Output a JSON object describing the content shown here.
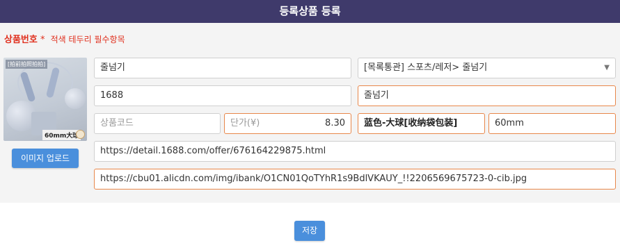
{
  "header": {
    "title": "등록상품 등록"
  },
  "section": {
    "label": "상품번호",
    "required_mark": "*",
    "note": "적색 테두리 필수항목"
  },
  "image": {
    "caption": "[拍前拍照拍拍]",
    "size_tag": "60mm大球"
  },
  "upload_button": "이미지 업로드",
  "fields": {
    "product_name": "줄넘기",
    "category": "[목록통관] 스포츠/레저> 줄넘기",
    "vendor": "1688",
    "name_ko": "줄넘기",
    "product_code_placeholder": "상품코드",
    "unit_price_label": "단가(¥)",
    "unit_price_value": "8.30",
    "option_color": "蓝色-大球[收纳袋包装]",
    "option_size": "60mm",
    "offer_url": "https://detail.1688.com/offer/676164229875.html",
    "image_url": "https://cbu01.alicdn.com/img/ibank/O1CN01QoTYhR1s9BdlVKAUY_!!2206569675723-0-cib.jpg"
  },
  "save_button": "저장",
  "colors": {
    "header_bg": "#3f3a6b",
    "required": "#e0301e",
    "primary": "#4a8fdc",
    "required_border": "#e8874a"
  }
}
